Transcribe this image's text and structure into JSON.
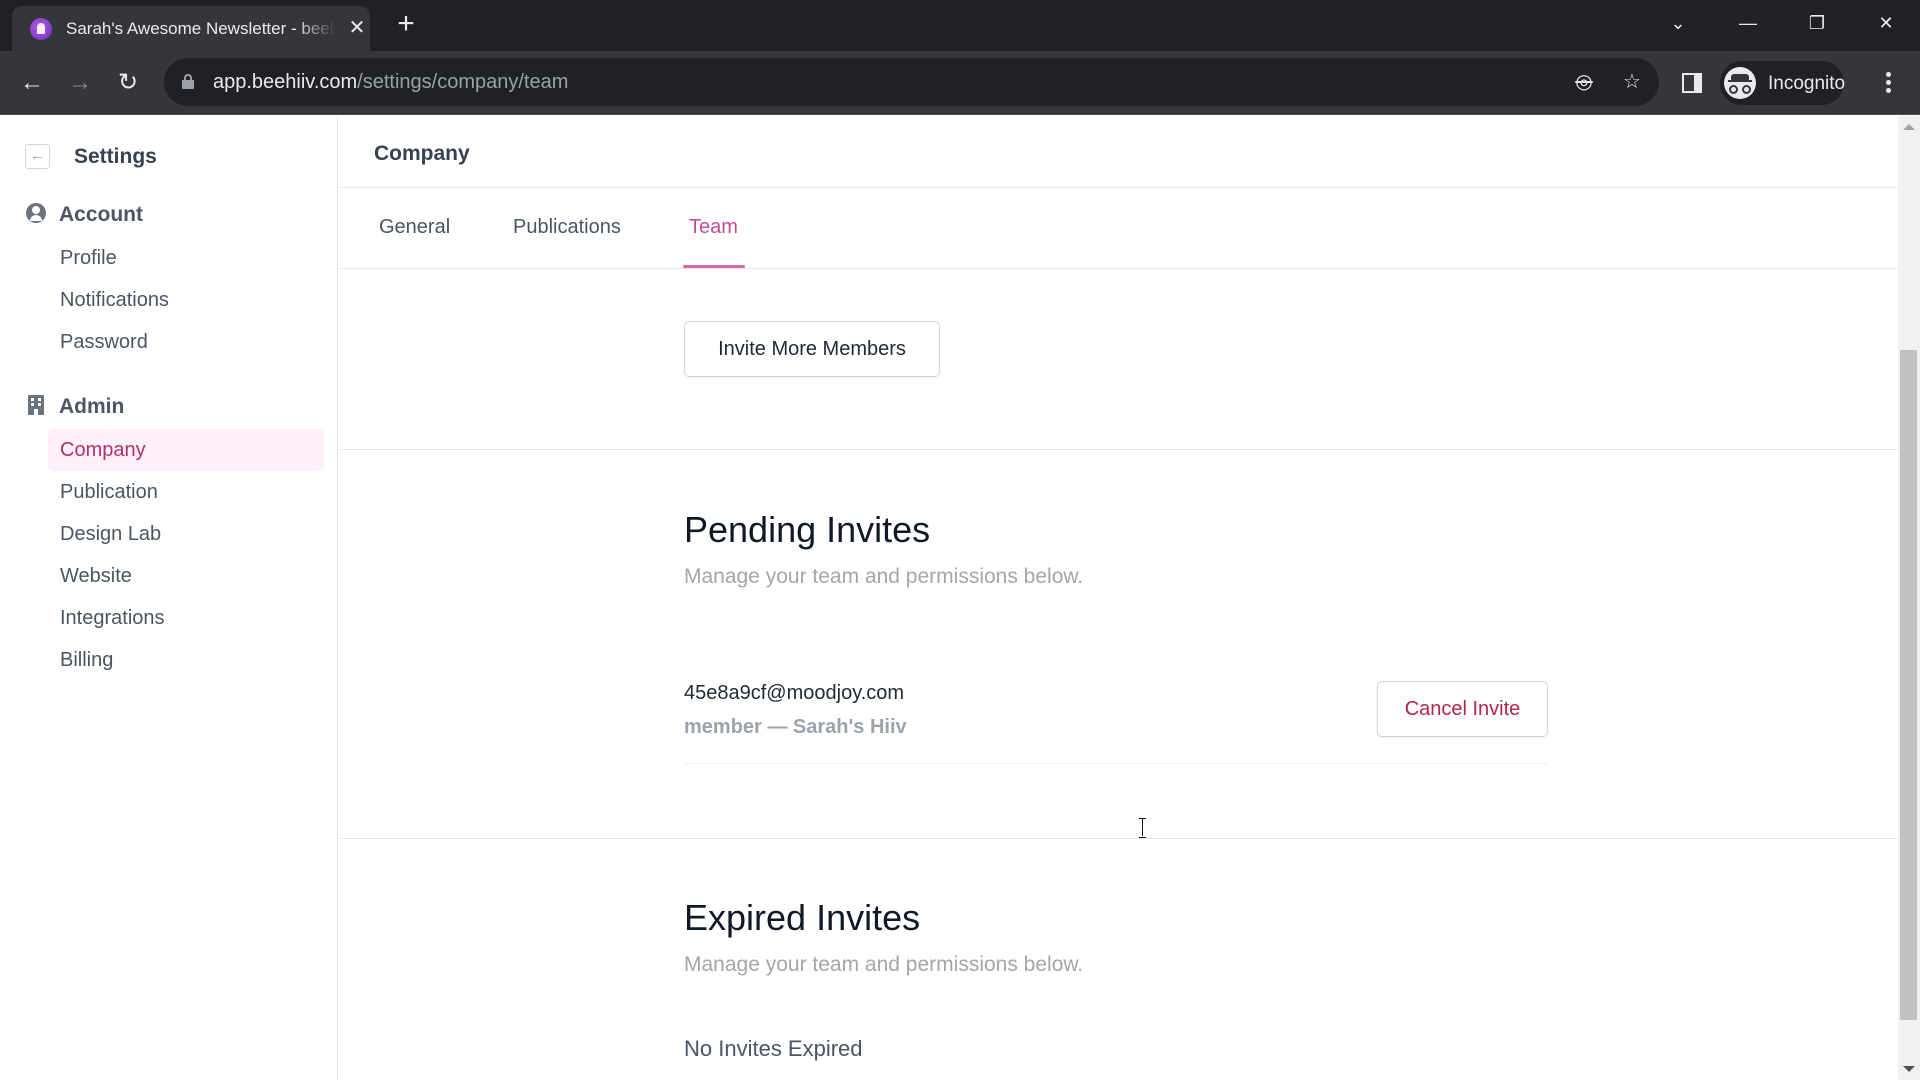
{
  "browser": {
    "tab_title": "Sarah's Awesome Newsletter - beehiiv",
    "tab_close": "✕",
    "new_tab": "+",
    "url_host": "app.beehiiv.com",
    "url_path": "/settings/company/team",
    "profile_label": "Incognito",
    "window_controls": {
      "tab_search": "⌄",
      "minimize": "—",
      "restore": "❐",
      "close": "✕"
    },
    "icons": {
      "back": "←",
      "forward": "→",
      "reload": "↻",
      "eye_off": "◎",
      "star": "☆"
    }
  },
  "sidebar": {
    "back_icon": "←",
    "title": "Settings",
    "groups": [
      {
        "label": "Account",
        "icon": "user-circle-icon",
        "items": [
          {
            "label": "Profile"
          },
          {
            "label": "Notifications"
          },
          {
            "label": "Password"
          }
        ]
      },
      {
        "label": "Admin",
        "icon": "building-icon",
        "items": [
          {
            "label": "Company",
            "active": true
          },
          {
            "label": "Publication"
          },
          {
            "label": "Design Lab"
          },
          {
            "label": "Website"
          },
          {
            "label": "Integrations"
          },
          {
            "label": "Billing"
          }
        ]
      }
    ]
  },
  "main": {
    "title": "Company",
    "tabs": [
      {
        "label": "General"
      },
      {
        "label": "Publications"
      },
      {
        "label": "Team",
        "active": true
      }
    ],
    "invite_button": "Invite More Members",
    "pending": {
      "heading": "Pending Invites",
      "subtitle": "Manage your team and permissions below.",
      "invites": [
        {
          "email": "45e8a9cf@moodjoy.com",
          "role": "member — Sarah's Hiiv",
          "action": "Cancel Invite"
        }
      ]
    },
    "expired": {
      "heading": "Expired Invites",
      "subtitle": "Manage your team and permissions below.",
      "empty_text": "No Invites Expired"
    }
  },
  "colors": {
    "accent": "#c14d8f",
    "active_bg": "#fdf0f8",
    "danger": "#b3264a"
  }
}
